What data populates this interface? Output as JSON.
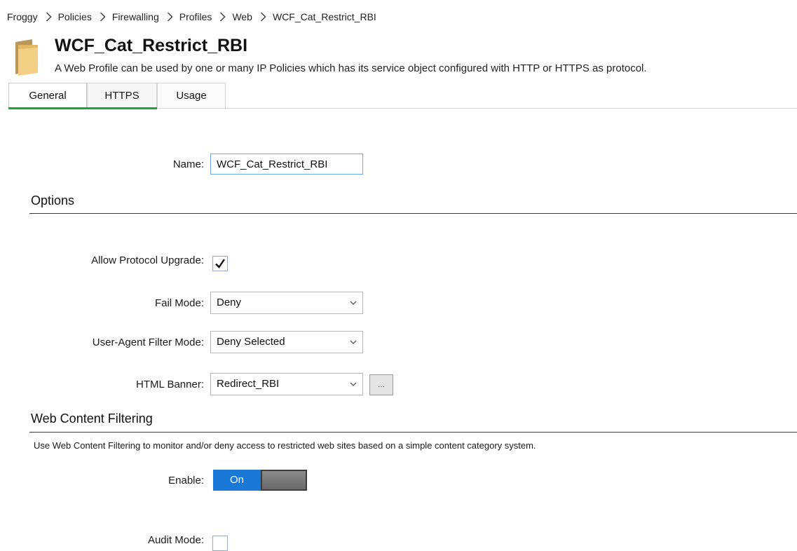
{
  "breadcrumb": {
    "items": [
      "Froggy",
      "Policies",
      "Firewalling",
      "Profiles",
      "Web",
      "WCF_Cat_Restrict_RBI"
    ]
  },
  "header": {
    "icon": "folder-icon",
    "title": "WCF_Cat_Restrict_RBI",
    "description": "A Web Profile can be used by one or many IP Policies which has its service object configured with HTTP or HTTPS as protocol."
  },
  "tabs": [
    {
      "label": "General",
      "active": true
    },
    {
      "label": "HTTPS",
      "active": false
    },
    {
      "label": "Usage",
      "active": false
    }
  ],
  "form": {
    "name_label": "Name:",
    "name_value": "WCF_Cat_Restrict_RBI"
  },
  "options": {
    "title": "Options",
    "allow_protocol_upgrade_label": "Allow Protocol Upgrade:",
    "allow_protocol_upgrade_checked": true,
    "fail_mode_label": "Fail Mode:",
    "fail_mode_value": "Deny",
    "ua_filter_label": "User-Agent Filter Mode:",
    "ua_filter_value": "Deny Selected",
    "html_banner_label": "HTML Banner:",
    "html_banner_value": "Redirect_RBI",
    "more_button_label": "..."
  },
  "wcf": {
    "title": "Web Content Filtering",
    "description": "Use Web Content Filtering to monitor and/or deny access to restricted web sites based on a simple content category system.",
    "enable_label": "Enable:",
    "enable_state": "On",
    "audit_mode_label": "Audit Mode:",
    "audit_mode_checked": false
  },
  "colors": {
    "accent": "#1a78d6",
    "tab_underline": "#1fa33f",
    "input_border": "#6aa8e6"
  }
}
